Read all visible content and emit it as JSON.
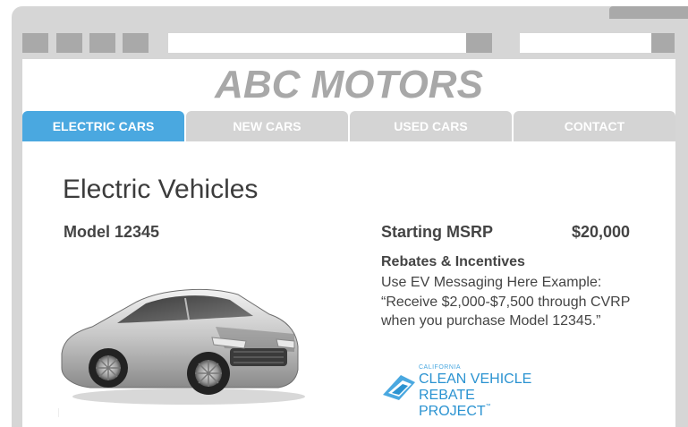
{
  "browser": {
    "toolbar_buttons": 4
  },
  "site": {
    "brand": "ABC MOTORS"
  },
  "nav": {
    "tabs": [
      {
        "label": "ELECTRIC CARS",
        "active": true
      },
      {
        "label": "NEW CARS",
        "active": false
      },
      {
        "label": "USED CARS",
        "active": false
      },
      {
        "label": "CONTACT",
        "active": false
      }
    ]
  },
  "main": {
    "heading": "Electric Vehicles",
    "model": "Model 12345",
    "msrp_label": "Starting MSRP",
    "msrp_price": "$20,000",
    "rebates_title": "Rebates & Incentives",
    "rebates_body": "Use EV Messaging Here Example: “Receive $2,000-$7,500 through CVRP when you purchase Model 12345.”",
    "car_image": "silver-sedan-image"
  },
  "logo": {
    "small": "CALIFORNIA",
    "line1": "CLEAN VEHICLE",
    "line2": "REBATE PROJECT",
    "tm": "™"
  },
  "colors": {
    "accent": "#4aa8e0",
    "tab_inactive": "#d4d4d4",
    "frame": "#d6d6d6",
    "brand_text": "#a8a8a8",
    "body_text": "#444444"
  }
}
